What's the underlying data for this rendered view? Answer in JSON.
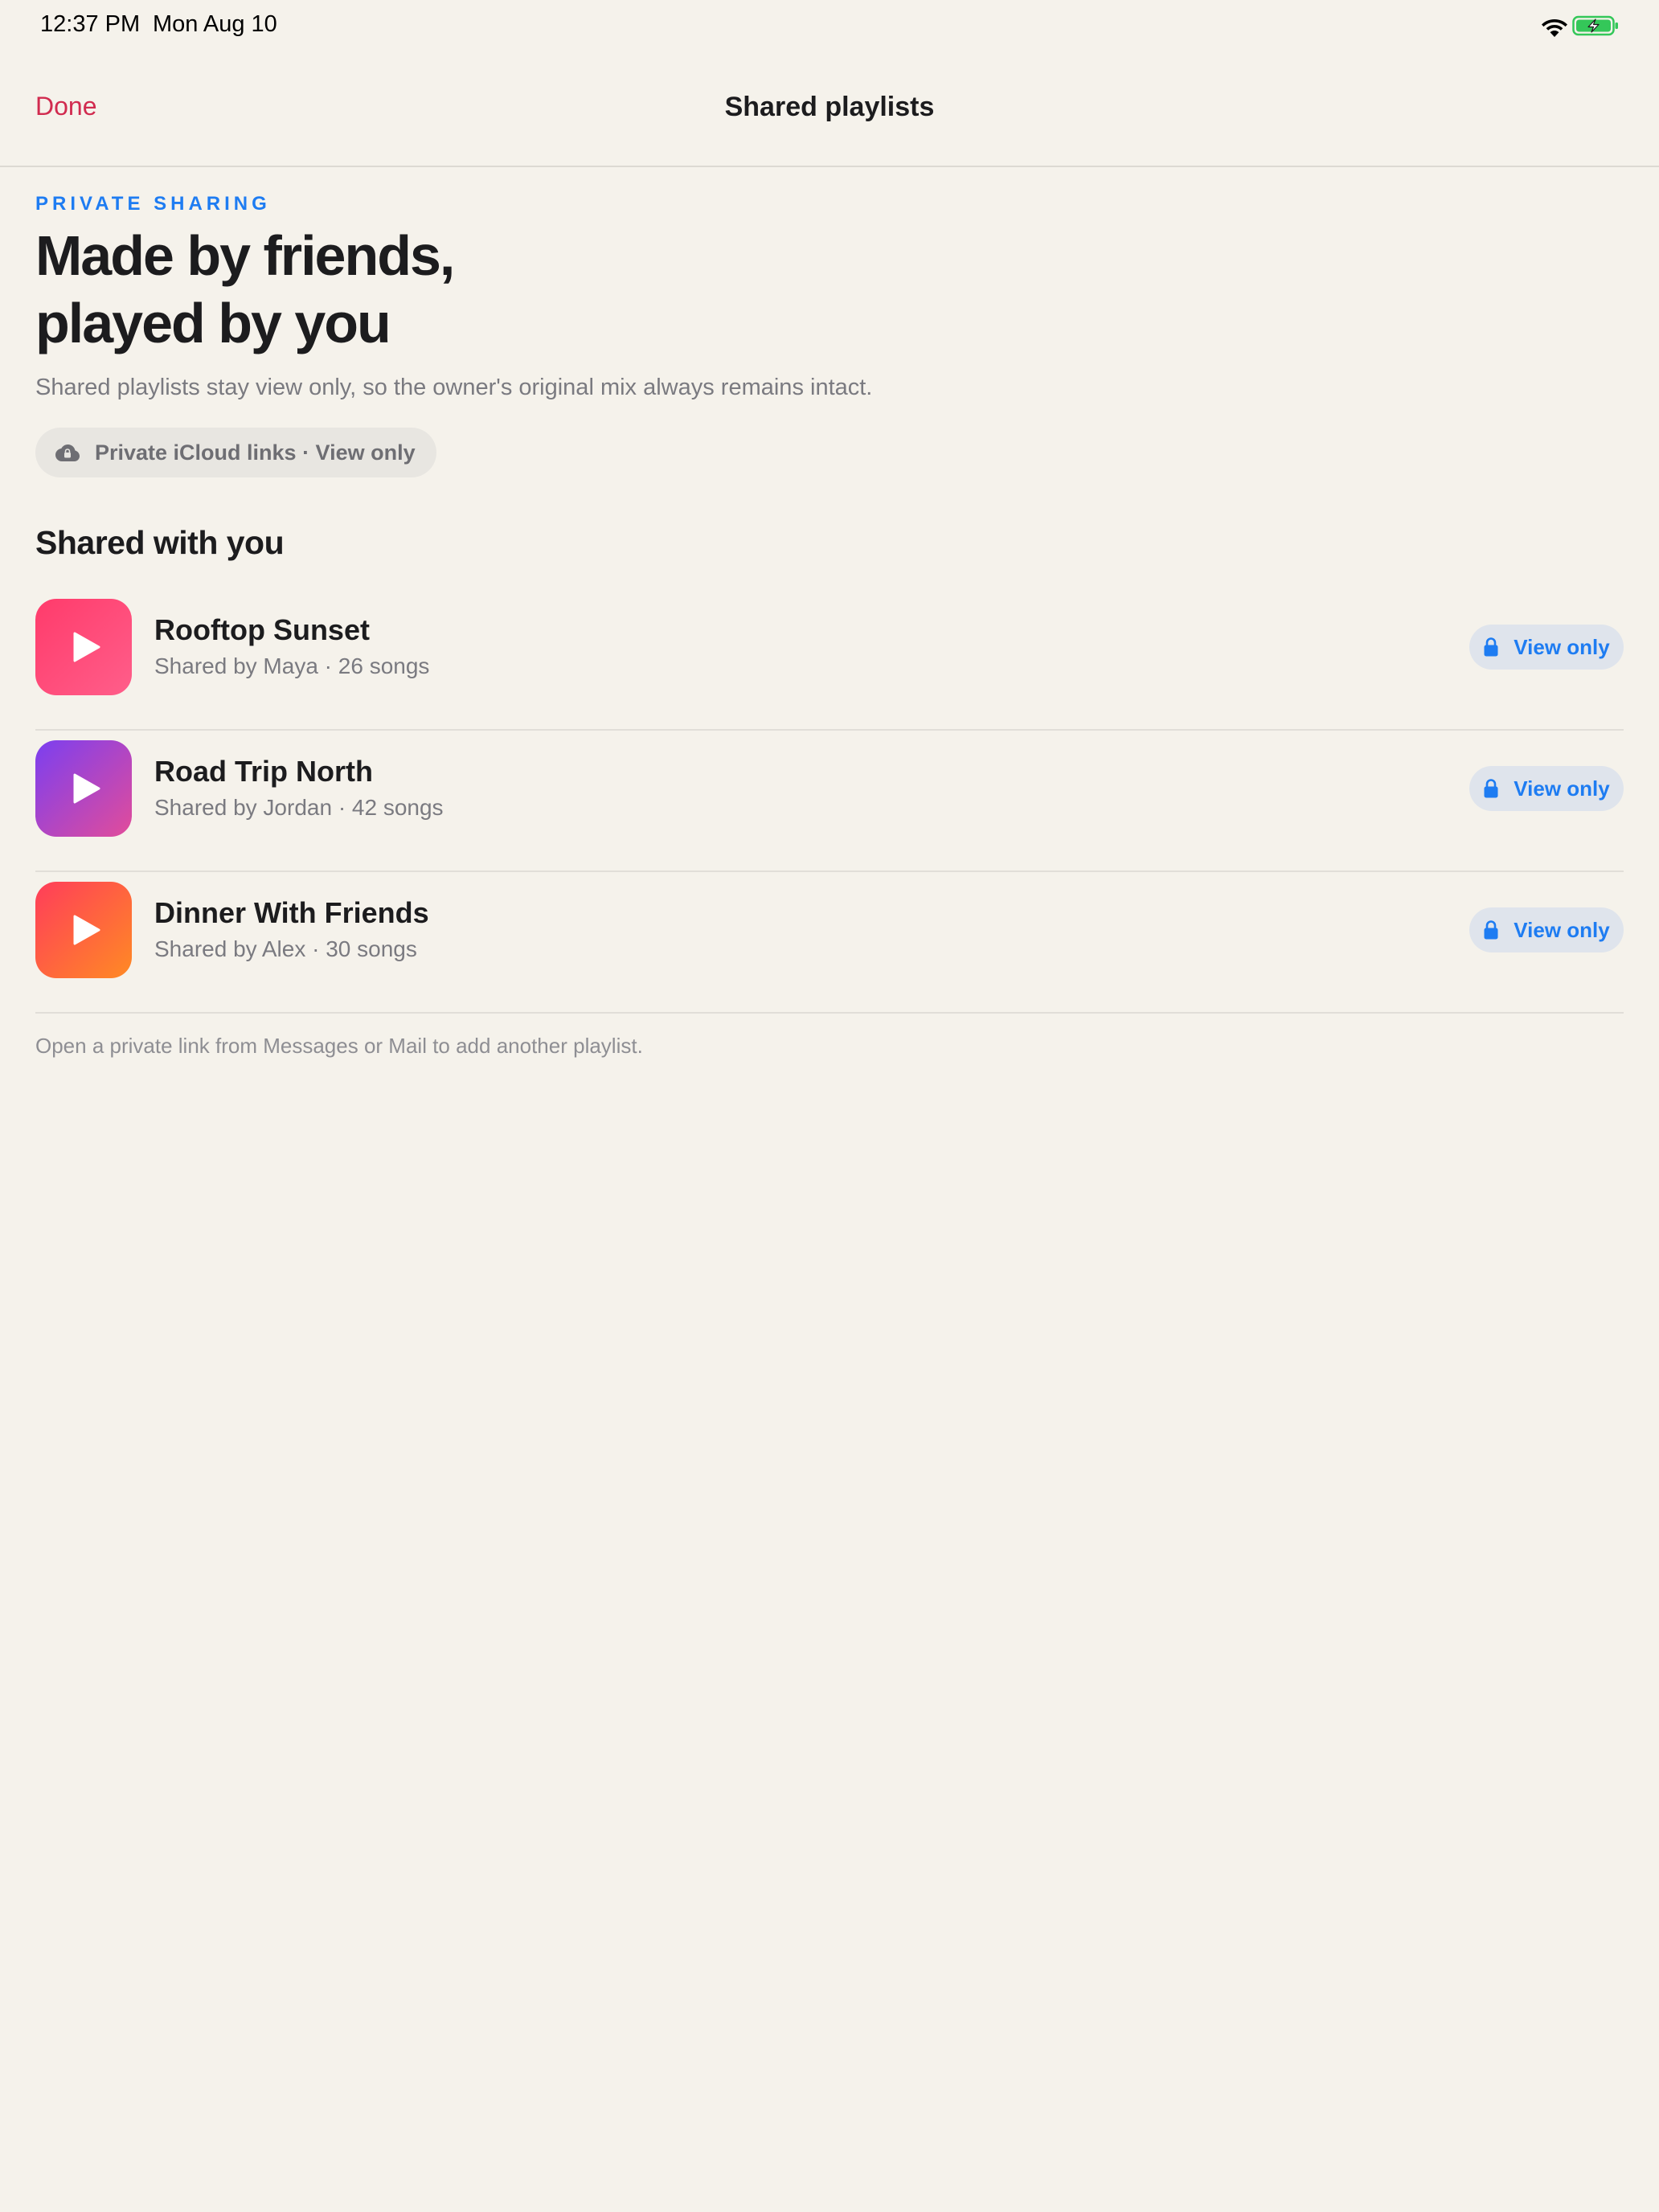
{
  "status_bar": {
    "time": "12:37 PM",
    "date": "Mon Aug 10",
    "icons": [
      "wifi-icon",
      "battery-charging-icon"
    ],
    "battery_color": "#34C759"
  },
  "nav": {
    "done_label": "Done",
    "title": "Shared playlists"
  },
  "header": {
    "eyebrow": "PRIVATE SHARING",
    "headline_line1": "Made by friends,",
    "headline_line2": "played by you",
    "subtitle": "Shared playlists stay view only, so the owner's original mix always remains intact.",
    "pill_label": "Private iCloud links · View only",
    "pill_icon": "cloud-lock-icon"
  },
  "section": {
    "title": "Shared with you"
  },
  "playlists": [
    {
      "title": "Rooftop Sunset",
      "subtitle": "Shared by Maya · 26 songs",
      "badge": "View only",
      "gradient": [
        "#FF3B6B",
        "#FF5E8A"
      ]
    },
    {
      "title": "Road Trip North",
      "subtitle": "Shared by Jordan · 42 songs",
      "badge": "View only",
      "gradient": [
        "#7B3FF0",
        "#E24C9A"
      ]
    },
    {
      "title": "Dinner With Friends",
      "subtitle": "Shared by Alex · 30 songs",
      "badge": "View only",
      "gradient": [
        "#FF3D5A",
        "#FF8A24"
      ]
    }
  ],
  "footnote": "Open a private link from Messages or Mail to add another playlist.",
  "colors": {
    "background": "#F5F2EB",
    "accent_red": "#D12B4F",
    "accent_blue": "#1E7CF2"
  }
}
